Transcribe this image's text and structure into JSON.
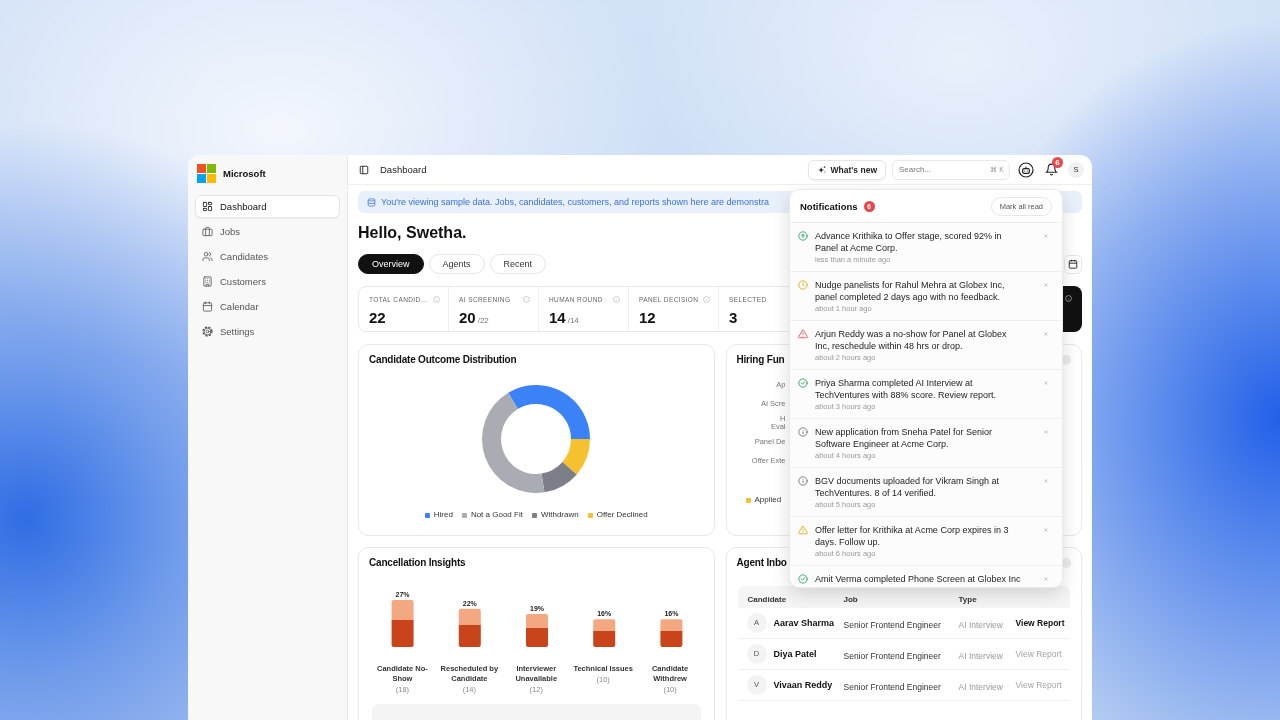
{
  "sidebar": {
    "brand": "Microsoft",
    "items": [
      {
        "label": "Dashboard",
        "selected": true
      },
      {
        "label": "Jobs",
        "selected": false
      },
      {
        "label": "Candidates",
        "selected": false
      },
      {
        "label": "Customers",
        "selected": false
      },
      {
        "label": "Calendar",
        "selected": false
      },
      {
        "label": "Settings",
        "selected": false
      }
    ]
  },
  "header": {
    "title": "Dashboard",
    "whats_new": "What's new",
    "search": {
      "placeholder": "Search...",
      "shortcut": "⌘ K"
    },
    "notification_count": "6",
    "avatar": "S"
  },
  "banner": "You're viewing sample data. Jobs, candidates, customers, and reports shown here are demonstra",
  "greeting": "Hello, Swetha.",
  "tabs": [
    {
      "label": "Overview",
      "selected": true
    },
    {
      "label": "Agents",
      "selected": false
    },
    {
      "label": "Recent",
      "selected": false
    }
  ],
  "stats": [
    {
      "label": "TOTAL CANDID…",
      "value": "22",
      "has_info": true
    },
    {
      "label": "AI SCREENING",
      "value": "20",
      "total": "/22",
      "has_info": true
    },
    {
      "label": "HUMAN ROUND",
      "value": "14",
      "total": "/14",
      "has_info": true
    },
    {
      "label": "PANEL DECISION",
      "value": "12",
      "has_info": true
    },
    {
      "label": "SELECTED",
      "value": "3",
      "has_info": false
    }
  ],
  "outcome_card": {
    "title": "Candidate Outcome Distribution",
    "legend": [
      {
        "label": "Hired",
        "color": "#3b82f6"
      },
      {
        "label": "Not a Good Fit",
        "color": "#a9acb3"
      },
      {
        "label": "Withdrawn",
        "color": "#7c7f87"
      },
      {
        "label": "Offer Declined",
        "color": "#f5c12e"
      }
    ]
  },
  "funnel_card": {
    "title": "Hiring Fun",
    "labels": [
      [
        "Ap"
      ],
      [
        "AI Scre"
      ],
      [
        "H",
        "Eval"
      ],
      [
        "Panel De"
      ],
      [
        "Offer Exte"
      ]
    ],
    "legend": [
      {
        "label": "Applied",
        "color": "#f5c12e"
      }
    ]
  },
  "cancellation_card": {
    "title": "Cancellation Insights",
    "chart_data": {
      "type": "bar",
      "categories": [
        "Candidate No-Show",
        "Rescheduled by Candidate",
        "Interviewer Unavailable",
        "Technical Issues",
        "Candidate Withdrew"
      ],
      "values": [
        27,
        22,
        19,
        16,
        16
      ],
      "value_labels": [
        "27%",
        "22%",
        "19%",
        "16%",
        "16%"
      ]
    },
    "counts": [
      "(18)",
      "(14)",
      "(12)",
      "(10)",
      "(10)"
    ]
  },
  "agent_inbox": {
    "title": "Agent Inbo",
    "columns": [
      "Candidate",
      "Job",
      "Type"
    ],
    "rows": [
      {
        "initial": "A",
        "name": "Aarav Sharma",
        "job": "Senior Frontend Engineer",
        "type": "AI Interview",
        "action": "View Report",
        "disabled": false
      },
      {
        "initial": "D",
        "name": "Diya Patel",
        "job": "Senior Frontend Engineer",
        "type": "AI Interview",
        "action": "View Report",
        "disabled": true
      },
      {
        "initial": "V",
        "name": "Vivaan Reddy",
        "job": "Senior Frontend Engineer",
        "type": "AI Interview",
        "action": "View Report",
        "disabled": true
      }
    ]
  },
  "notifications": {
    "title": "Notifications",
    "count": "6",
    "mark_all": "Mark all read",
    "items": [
      {
        "kind": "promotion",
        "text": "Advance Krithika to Offer stage, scored 92% in Panel at Acme Corp.",
        "time": "less than a minute ago"
      },
      {
        "kind": "reminder",
        "text": "Nudge panelists for Rahul Mehra at Globex Inc, panel completed 2 days ago with no feedback.",
        "time": "about 1 hour ago"
      },
      {
        "kind": "alert",
        "text": "Arjun Reddy was a no-show for Panel at Globex Inc, reschedule within 48 hrs or drop.",
        "time": "about 2 hours ago"
      },
      {
        "kind": "success",
        "text": "Priya Sharma completed AI Interview at TechVentures with 88% score. Review report.",
        "time": "about 3 hours ago"
      },
      {
        "kind": "info",
        "text": "New application from Sneha Patel for Senior Software Engineer at Acme Corp.",
        "time": "about 4 hours ago"
      },
      {
        "kind": "info",
        "text": "BGV documents uploaded for Vikram Singh at TechVentures. 8 of 14 verified.",
        "time": "about 5 hours ago"
      },
      {
        "kind": "warning",
        "text": "Offer letter for Krithika at Acme Corp expires in 3 days. Follow up.",
        "time": "about 6 hours ago"
      },
      {
        "kind": "success",
        "text": "Amit Verma completed Phone Screen at Globex Inc"
      }
    ]
  }
}
